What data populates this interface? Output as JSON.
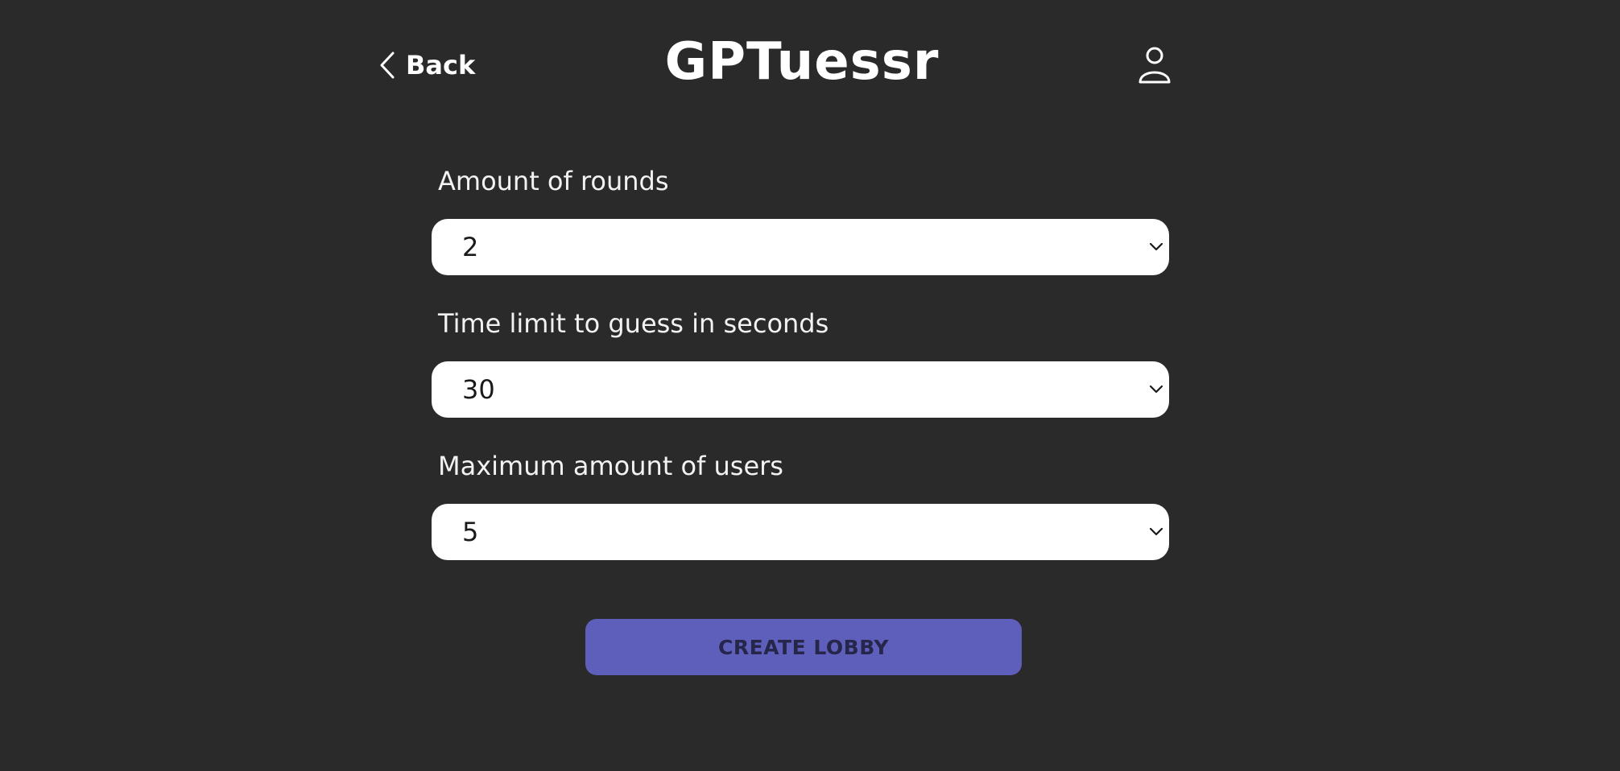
{
  "header": {
    "back_label": "Back",
    "back_icon": "chevron-left-icon",
    "title": "GPTuessr",
    "profile_icon": "user-icon"
  },
  "form": {
    "rounds": {
      "label": "Amount of rounds",
      "value": "2"
    },
    "time_limit": {
      "label": "Time limit to guess in seconds",
      "value": "30"
    },
    "max_users": {
      "label": "Maximum amount of users",
      "value": "5"
    }
  },
  "actions": {
    "create_label": "CREATE LOBBY"
  },
  "colors": {
    "background": "#2a2a2a",
    "accent": "#5e5fba",
    "field_bg": "#ffffff",
    "text": "#ffffff"
  }
}
